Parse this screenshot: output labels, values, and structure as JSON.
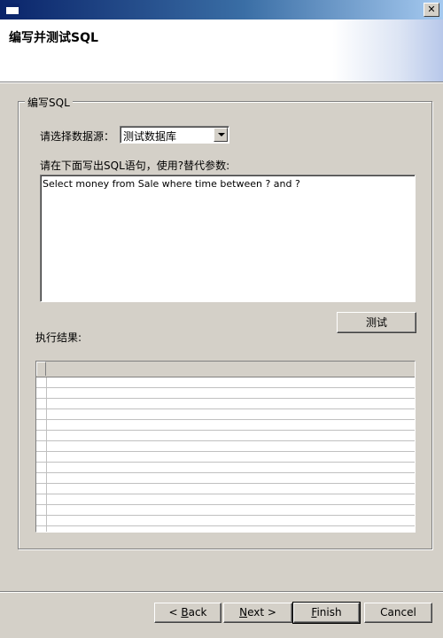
{
  "window": {
    "close_glyph": "✕"
  },
  "banner": {
    "title": "编写并测试SQL"
  },
  "group": {
    "legend": "编写SQL",
    "datasource_label": "请选择数据源：",
    "datasource_value": "测试数据库",
    "sql_prompt": "请在下面写出SQL语句，使用?替代参数:",
    "sql_text": "Select money from Sale where time between ? and ?",
    "test_button": "测试",
    "result_label": "执行结果:"
  },
  "footer": {
    "back": {
      "pre": "< ",
      "key": "B",
      "post": "ack"
    },
    "next": {
      "key": "N",
      "post": "ext >"
    },
    "finish": {
      "key": "F",
      "post": "inish"
    },
    "cancel": "Cancel"
  },
  "colors": {
    "titlebar_start": "#0a246a",
    "face": "#d4d0c8"
  }
}
